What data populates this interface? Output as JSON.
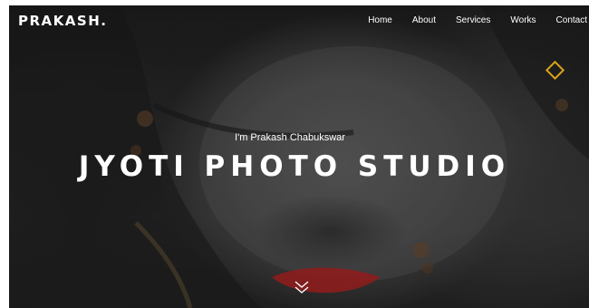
{
  "brand": {
    "logo": "PRAKASH."
  },
  "nav": {
    "items": [
      {
        "label": "Home"
      },
      {
        "label": "About"
      },
      {
        "label": "Services"
      },
      {
        "label": "Works"
      },
      {
        "label": "Contact"
      }
    ]
  },
  "hero": {
    "subtitle": "I'm Prakash Chabukswar",
    "title": "JYOTI PHOTO STUDIO",
    "scroll_icon": "double-chevron-down-icon",
    "accent_icon": "diamond-outline-icon"
  },
  "colors": {
    "accent": "#d9a21b",
    "text": "#ffffff",
    "lips": "#b22222"
  }
}
